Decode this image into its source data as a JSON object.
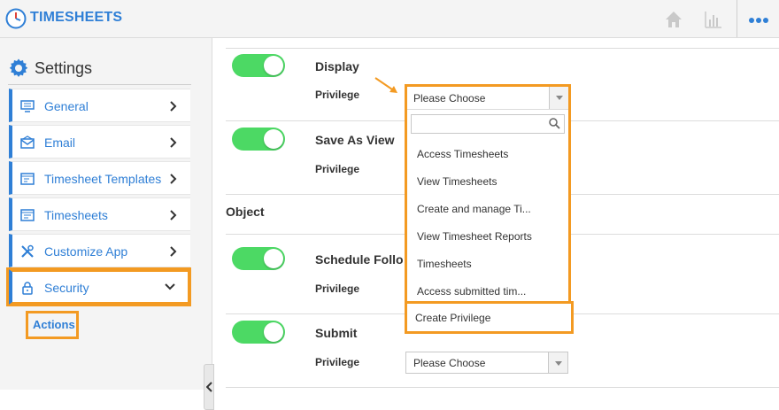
{
  "app": {
    "title": "TIMESHEETS"
  },
  "topbar": {
    "icons": [
      "home-icon",
      "bar-chart-icon",
      "more-icon"
    ]
  },
  "sidebar": {
    "title": "Settings",
    "items": [
      {
        "label": "General",
        "icon": "monitor-icon"
      },
      {
        "label": "Email",
        "icon": "envelope-icon"
      },
      {
        "label": "Timesheet Templates",
        "icon": "template-icon"
      },
      {
        "label": "Timesheets",
        "icon": "timesheet-icon"
      },
      {
        "label": "Customize App",
        "icon": "tools-icon"
      },
      {
        "label": "Security",
        "icon": "lock-icon"
      }
    ],
    "sub_item": "Actions"
  },
  "main": {
    "rows": [
      {
        "title": "Display",
        "privilege_label": "Privilege",
        "enabled": true
      },
      {
        "title": "Save As View",
        "privilege_label": "Privilege",
        "enabled": true
      },
      {
        "title": "Schedule Follo",
        "privilege_label": "Privilege",
        "enabled": true
      },
      {
        "title": "Submit",
        "privilege_label": "Privilege",
        "enabled": true
      }
    ],
    "section_title": "Object",
    "select_placeholder": "Please Choose",
    "bottom_select_value": "Please Choose"
  },
  "dropdown": {
    "selected": "Please Choose",
    "search_value": "",
    "options": [
      "Access Timesheets",
      "View Timesheets",
      "Create and manage Ti...",
      "View Timesheet Reports",
      "Timesheets",
      "Access submitted tim..."
    ],
    "create_label": "Create Privilege"
  },
  "colors": {
    "accent": "#2f7fd6",
    "highlight": "#f39a22",
    "toggle_on": "#4cd964"
  }
}
